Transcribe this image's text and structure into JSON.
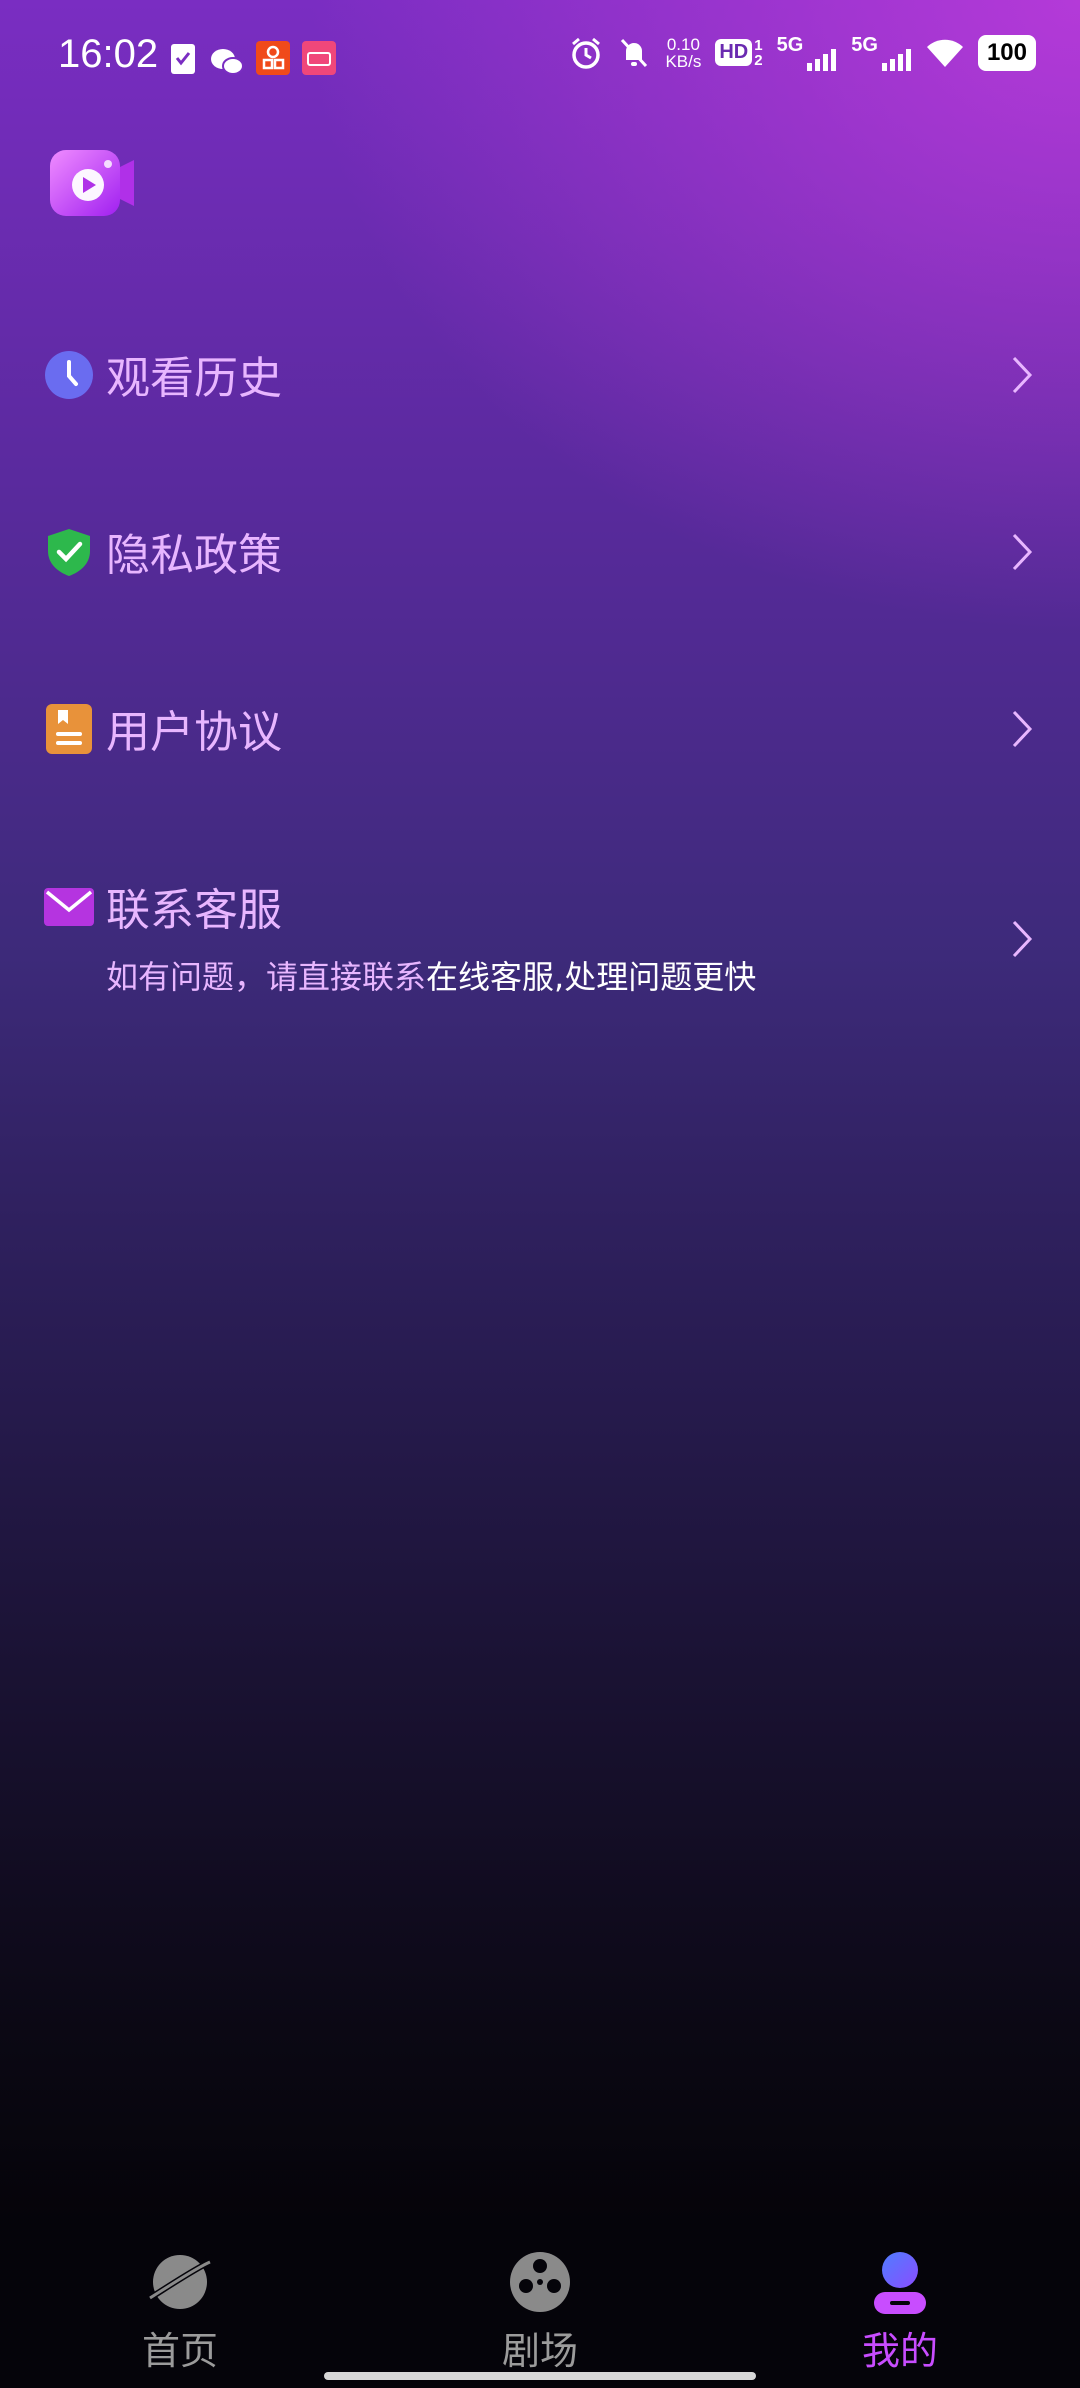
{
  "status_bar": {
    "time": "16:02",
    "net_speed_value": "0.10",
    "net_speed_unit": "KB/s",
    "hd_label": "HD",
    "sim1": "1",
    "sim2": "2",
    "sig1": "5G",
    "sig2": "5G",
    "battery": "100"
  },
  "menu": {
    "history": {
      "label": "观看历史",
      "icon": "clock-icon",
      "color": "#6a6cf0"
    },
    "privacy": {
      "label": "隐私政策",
      "icon": "shield-check-icon",
      "color": "#2db84c"
    },
    "agreement": {
      "label": "用户协议",
      "icon": "document-icon",
      "color": "#e8923a"
    },
    "support": {
      "label": "联系客服",
      "icon": "mail-icon",
      "color": "#b534e0",
      "sub_pink": "如有问题，请直接联系",
      "sub_white": "在线客服,处理问题更快"
    }
  },
  "nav": {
    "tabs": [
      {
        "label": "首页",
        "icon": "planet-icon",
        "active": false
      },
      {
        "label": "剧场",
        "icon": "film-reel-icon",
        "active": false
      },
      {
        "label": "我的",
        "icon": "user-icon",
        "active": true
      }
    ],
    "active_color": "#c84dff",
    "inactive_color": "#9b9b9b"
  }
}
